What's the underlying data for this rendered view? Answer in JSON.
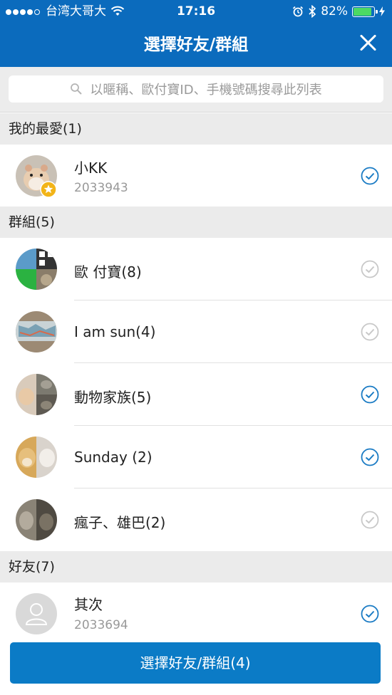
{
  "status": {
    "carrier": "台湾大哥大",
    "time": "17:16",
    "battery": "82%",
    "battery_level": 0.82
  },
  "header": {
    "title": "選擇好友/群組"
  },
  "search": {
    "placeholder": "以暱稱、歐付寶ID、手機號碼搜尋此列表"
  },
  "sections": {
    "favorites": "我的最愛(1)",
    "groups": "群組(5)",
    "friends": "好友(7)"
  },
  "favorites": [
    {
      "name": "小KK",
      "id": "2033943",
      "checked": true
    }
  ],
  "groups": [
    {
      "name": "歐 付寶(8)",
      "checked": false
    },
    {
      "name": "I am sun(4)",
      "checked": false
    },
    {
      "name": "動物家族(5)",
      "checked": true
    },
    {
      "name": "Sunday (2)",
      "checked": true
    },
    {
      "name": "瘋子、雄巴(2)",
      "checked": false
    }
  ],
  "friends": [
    {
      "name": "其次",
      "id": "2033694",
      "checked": true
    }
  ],
  "bottom_button": {
    "label": "選擇好友/群組(4)"
  },
  "colors": {
    "primary": "#0b6bbd",
    "check_on": "#1a7bc4",
    "check_off": "#c8c8c8"
  }
}
